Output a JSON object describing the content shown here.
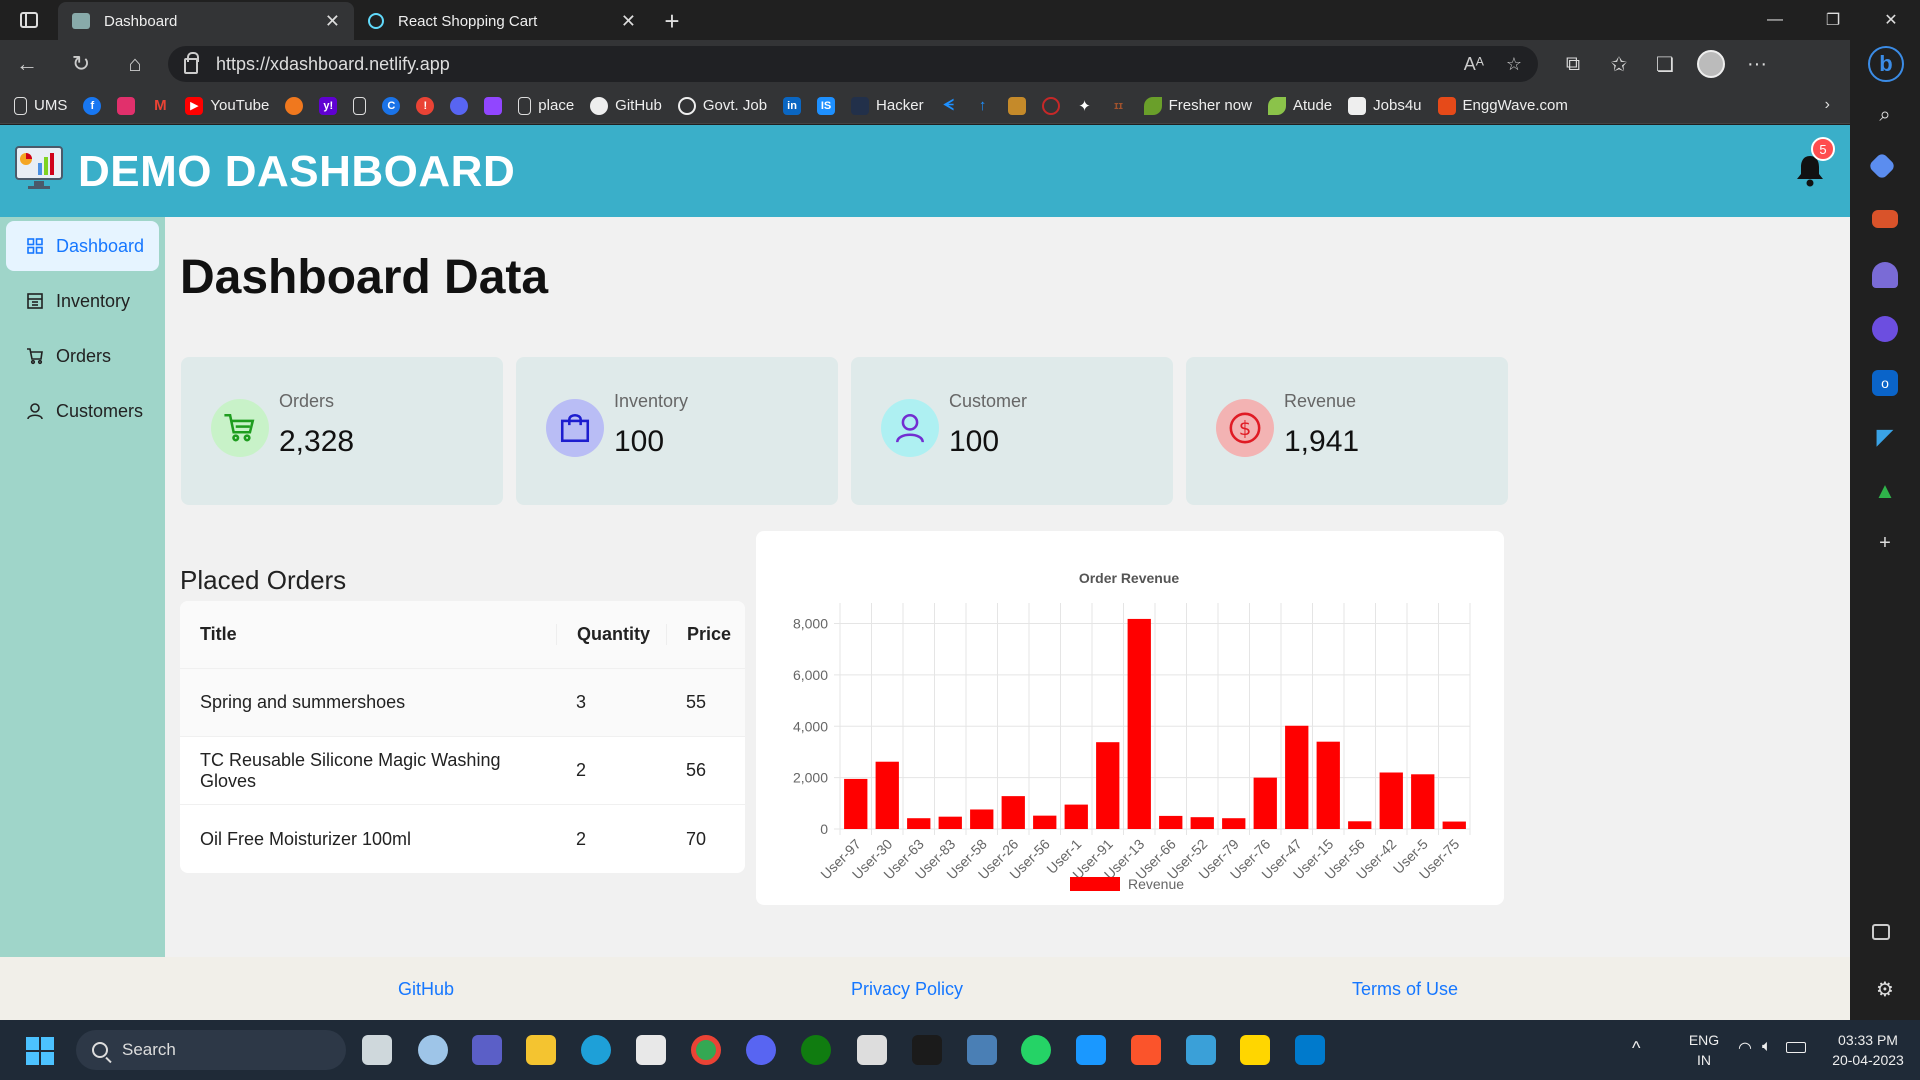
{
  "browser": {
    "tabs": [
      {
        "label": "Dashboard",
        "active": true
      },
      {
        "label": "React Shopping Cart",
        "active": false
      }
    ],
    "url": "https://xdashboard.netlify.app",
    "bookmarks": [
      "UMS",
      "YouTube",
      "place",
      "GitHub",
      "Govt. Job",
      "Hacker",
      "Fresher now",
      "Atude",
      "Jobs4u",
      "EnggWave.com"
    ]
  },
  "header": {
    "title": "DEMO DASHBOARD",
    "notification_count": "5"
  },
  "sidebar": {
    "items": [
      {
        "label": "Dashboard",
        "active": true
      },
      {
        "label": "Inventory",
        "active": false
      },
      {
        "label": "Orders",
        "active": false
      },
      {
        "label": "Customers",
        "active": false
      }
    ]
  },
  "main": {
    "title": "Dashboard Data",
    "cards": [
      {
        "label": "Orders",
        "value": "2,328",
        "icon": "shopping-cart-icon",
        "color": "#52c41a",
        "bg": "#c8f2c8"
      },
      {
        "label": "Inventory",
        "value": "100",
        "icon": "shopping-bag-icon",
        "color": "#1d1dcf",
        "bg": "#b9bdf5"
      },
      {
        "label": "Customer",
        "value": "100",
        "icon": "user-icon",
        "color": "#722ed1",
        "bg": "#aef0f2"
      },
      {
        "label": "Revenue",
        "value": "1,941",
        "icon": "dollar-circle-icon",
        "color": "#f5222d",
        "bg": "#f3b3b3"
      }
    ],
    "orders_table": {
      "title": "Placed Orders",
      "columns": [
        "Title",
        "Quantity",
        "Price"
      ],
      "rows": [
        [
          "Spring and summershoes",
          "3",
          "55"
        ],
        [
          "TC Reusable Silicone Magic Washing Gloves",
          "2",
          "56"
        ],
        [
          "Oil Free Moisturizer 100ml",
          "2",
          "70"
        ]
      ]
    }
  },
  "chart_data": {
    "type": "bar",
    "title": "Order Revenue",
    "categories": [
      "User-97",
      "User-30",
      "User-63",
      "User-83",
      "User-58",
      "User-26",
      "User-56",
      "User-1",
      "User-91",
      "User-13",
      "User-66",
      "User-52",
      "User-79",
      "User-76",
      "User-47",
      "User-15",
      "User-56",
      "User-42",
      "User-5",
      "User-75"
    ],
    "series": [
      {
        "name": "Revenue",
        "color": "#ff0000",
        "values": [
          1950,
          2620,
          420,
          480,
          760,
          1280,
          520,
          950,
          3380,
          8180,
          510,
          460,
          420,
          2000,
          4020,
          3400,
          300,
          2200,
          2130,
          290
        ]
      }
    ],
    "yticks": [
      "0",
      "2,000",
      "4,000",
      "6,000",
      "8,000"
    ],
    "ylim": [
      0,
      8800
    ],
    "grid": true,
    "legend": "bottom"
  },
  "footer": {
    "links": [
      "GitHub",
      "Privacy Policy",
      "Terms of Use"
    ]
  },
  "taskbar": {
    "search_placeholder": "Search",
    "lang_top": "ENG",
    "lang_bottom": "IN",
    "time": "03:33 PM",
    "date": "20-04-2023"
  }
}
